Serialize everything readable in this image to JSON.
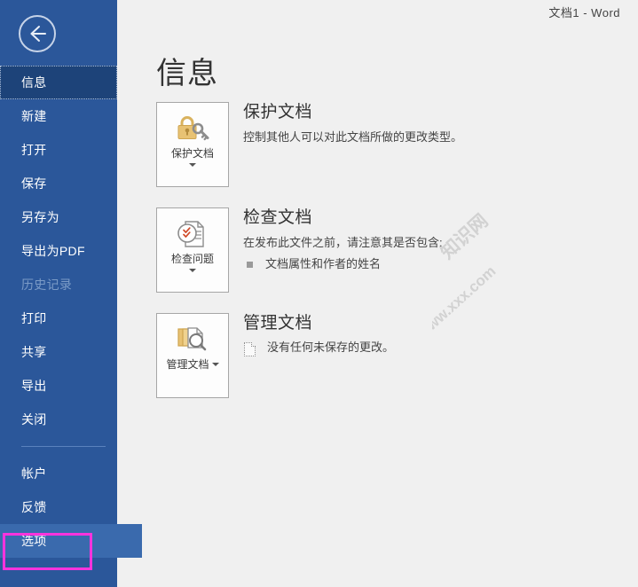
{
  "window": {
    "title": "文档1 -  Word"
  },
  "sidebar": {
    "back_icon": "back-arrow-icon",
    "items": [
      {
        "label": "信息",
        "state": "selected"
      },
      {
        "label": "新建",
        "state": "normal"
      },
      {
        "label": "打开",
        "state": "normal"
      },
      {
        "label": "保存",
        "state": "normal"
      },
      {
        "label": "另存为",
        "state": "normal"
      },
      {
        "label": "导出为PDF",
        "state": "normal"
      },
      {
        "label": "历史记录",
        "state": "disabled"
      },
      {
        "label": "打印",
        "state": "normal"
      },
      {
        "label": "共享",
        "state": "normal"
      },
      {
        "label": "导出",
        "state": "normal"
      },
      {
        "label": "关闭",
        "state": "normal"
      }
    ],
    "bottom_items": [
      {
        "label": "帐户",
        "state": "normal"
      },
      {
        "label": "反馈",
        "state": "normal"
      },
      {
        "label": "选项",
        "state": "hovered"
      }
    ],
    "colors": {
      "background": "#2b579a",
      "selected": "#1d4379",
      "hover": "#3a6aad",
      "highlight_box": "#ff33dd",
      "disabled_text": "#7b9bc7"
    }
  },
  "main": {
    "page_title": "信息",
    "watermark": {
      "line1": "知识网",
      "line2": "www.xxx.com"
    },
    "sections": [
      {
        "tile_icon": "lock-key-icon",
        "tile_label": "保护文档",
        "heading": "保护文档",
        "description": "控制其他人可以对此文档所做的更改类型。",
        "bullets": []
      },
      {
        "tile_icon": "document-inspect-icon",
        "tile_label": "检查问题",
        "heading": "检查文档",
        "description": "在发布此文件之前，请注意其是否包含:",
        "bullets": [
          {
            "icon": "square-bullet-icon",
            "text": "文档属性和作者的姓名"
          }
        ]
      },
      {
        "tile_icon": "manage-documents-icon",
        "tile_label": "管理文档",
        "heading": "管理文档",
        "description": "",
        "bullets": [
          {
            "icon": "draft-document-icon",
            "text": "没有任何未保存的更改。"
          }
        ]
      }
    ]
  }
}
